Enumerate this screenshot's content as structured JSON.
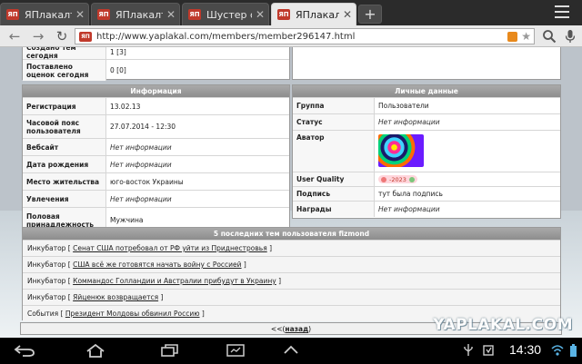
{
  "tabs": [
    {
      "label": "ЯПлакалъ",
      "active": false
    },
    {
      "label": "ЯПлакалъ",
      "active": false
    },
    {
      "label": "Шустер сле...",
      "active": false
    },
    {
      "label": "ЯПлакалъ",
      "active": true
    }
  ],
  "favicon_text": "ЯП",
  "newtab_label": "+",
  "url": "http://www.yaplakal.com/members/member296147.html",
  "top_rows": [
    {
      "key": "Создано тем сегодня",
      "value": "1 [3]"
    },
    {
      "key": "Поставлено оценок сегодня",
      "value": "0 [0]"
    }
  ],
  "info": {
    "title": "Информация",
    "rows": [
      {
        "key": "Регистрация",
        "value": "13.02.13",
        "italic": false
      },
      {
        "key": "Часовой пояс пользователя",
        "value": "27.07.2014 - 12:30",
        "italic": false
      },
      {
        "key": "Вебсайт",
        "value": "Нет информации",
        "italic": true
      },
      {
        "key": "Дата рождения",
        "value": "Нет информации",
        "italic": true
      },
      {
        "key": "Место жительства",
        "value": "юго-восток Украины",
        "italic": false
      },
      {
        "key": "Увлечения",
        "value": "Нет информации",
        "italic": true
      },
      {
        "key": "Половая принадлежность",
        "value": "Мужчина",
        "italic": false
      }
    ]
  },
  "personal": {
    "title": "Личные данные",
    "group": {
      "key": "Группа",
      "value": "Пользователи"
    },
    "status": {
      "key": "Статус",
      "value": "Нет информации"
    },
    "avatar_key": "Аватор",
    "quality": {
      "key": "User Quality",
      "value": "-2023"
    },
    "signature": {
      "key": "Подпись",
      "value": "тут была подпись"
    },
    "awards": {
      "key": "Награды",
      "value": "Нет информации"
    }
  },
  "topics": {
    "title": "5 последних тем пользователя fizmond",
    "items": [
      {
        "section": "Инкубатор",
        "link": "Сенат США потребовал от РФ уйти из Приднестровья"
      },
      {
        "section": "Инкубатор",
        "link": "США всё же готовятся начать войну с Россией"
      },
      {
        "section": "Инкубатор",
        "link": "Коммандос Голландии и Австралии прибудут в Украину"
      },
      {
        "section": "Инкубатор",
        "link": "Яйценюк возвращается"
      },
      {
        "section": "События",
        "link": "Президент Молдовы обвинил Россию"
      }
    ]
  },
  "back": {
    "prefix": "<<(",
    "link": "назад",
    "suffix": ")"
  },
  "watermark": "YAPLAKAL.COM",
  "clock": "14:30",
  "colors": {
    "page_bg": "#bcc3ca",
    "panel_title": "#8d8d8d",
    "favicon": "#c0392b"
  }
}
